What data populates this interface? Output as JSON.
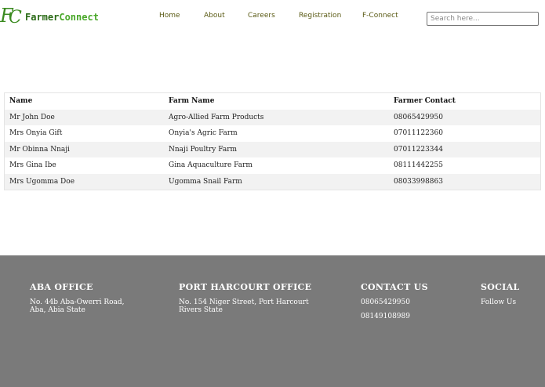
{
  "brand": {
    "mark_f": "F",
    "mark_c": "C",
    "name_part1": "Farmer",
    "name_part2": "Connect"
  },
  "nav": {
    "items": [
      "Home",
      "About",
      "Careers",
      "Registration",
      "F-Connect"
    ]
  },
  "search": {
    "placeholder": "Search here..."
  },
  "table": {
    "headers": [
      "Name",
      "Farm Name",
      "Farmer Contact"
    ],
    "rows": [
      [
        "Mr John Doe",
        "Agro-Allied Farm Products",
        "08065429950"
      ],
      [
        "Mrs Onyia Gift",
        "Onyia's Agric Farm",
        "07011122360"
      ],
      [
        "Mr Obinna Nnaji",
        "Nnaji Poultry Farm",
        "07011223344"
      ],
      [
        "Mrs Gina Ibe",
        "Gina Aquaculture Farm",
        "08111442255"
      ],
      [
        "Mrs Ugomma Doe",
        "Ugomma Snail Farm",
        "08033998863"
      ]
    ]
  },
  "footer": {
    "aba": {
      "title": "ABA OFFICE",
      "address": "No. 44b Aba-Owerri Road,\nAba, Abia State"
    },
    "ph": {
      "title": "PORT HARCOURT OFFICE",
      "address": "No. 154 Niger Street, Port Harcourt\nRivers State"
    },
    "contact": {
      "title": "CONTACT US",
      "phones": [
        "08065429950",
        "08149108989"
      ]
    },
    "social": {
      "title": "SOCIAL",
      "text": "Follow Us"
    }
  },
  "colors": {
    "brand_dark": "#2a6a16",
    "brand_light": "#4aa82a",
    "nav_text": "#5a5a14",
    "footer_bg": "#7a7a7a",
    "row_alt": "#f2f2f2"
  }
}
